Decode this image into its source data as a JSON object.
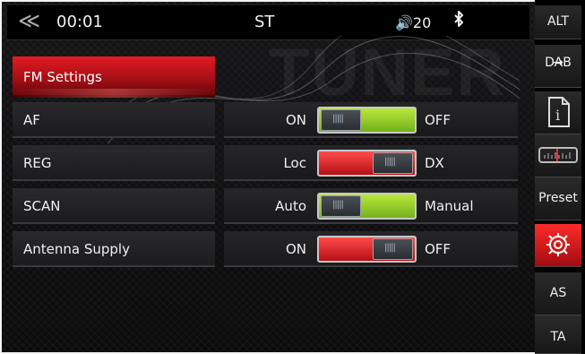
{
  "status_bar": {
    "back_symbol": "≪",
    "time": "00:01",
    "st": "ST",
    "volume": "🔊20"
  },
  "background": {
    "word": "TUNER"
  },
  "panel": {
    "title": "FM Settings",
    "rows": [
      {
        "label": "AF",
        "left": "ON",
        "right": "OFF",
        "state": "green",
        "level": 0
      },
      {
        "label": "REG",
        "left": "Loc",
        "right": "DX",
        "state": "red",
        "level": 1
      },
      {
        "label": "SCAN",
        "left": "Auto",
        "right": "Manual",
        "state": "green",
        "level": 0
      },
      {
        "label": "Antenna Supply",
        "left": "ON",
        "right": "OFF",
        "state": "red",
        "level": 1
      }
    ]
  },
  "sidebar": {
    "alt": "ALT",
    "dab": "DAB",
    "dab_arrow": "→",
    "info": "i",
    "preset": "Preset",
    "as": "AS",
    "ta": "TA"
  },
  "colors": {
    "red": "#e31a23",
    "green": "#9ad12b",
    "bg": "#0b0b0c",
    "sidebar": "#000000"
  },
  "icons": {
    "back": "double-chevron-left-icon",
    "bluetooth": "bluetooth-icon",
    "info": "info-icon",
    "tuner_scale": "frequency-scale-icon",
    "settings": "gear-icon"
  }
}
